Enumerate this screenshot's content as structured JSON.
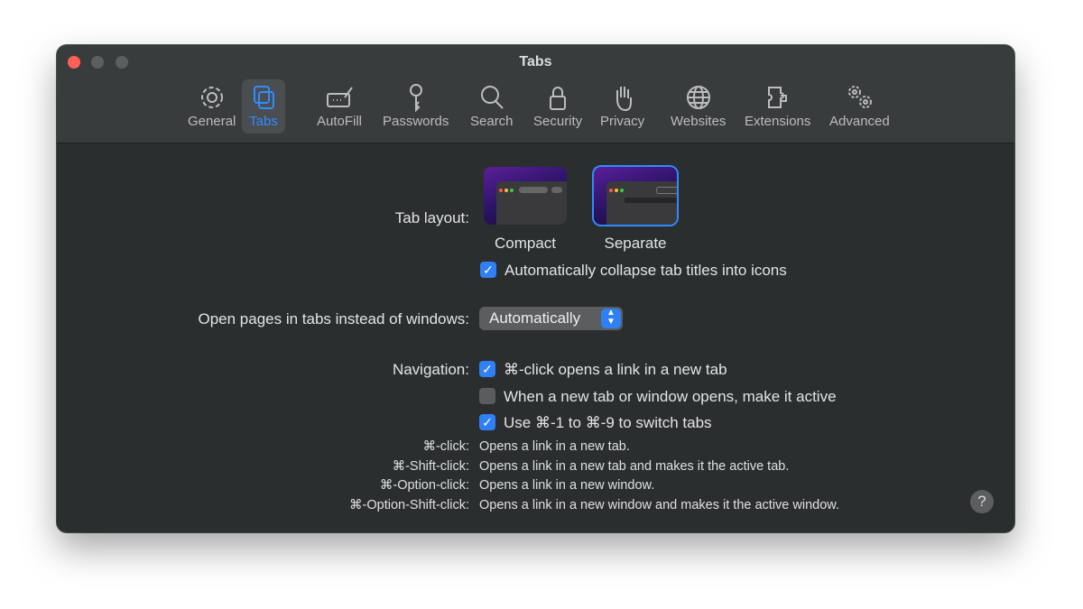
{
  "window": {
    "title": "Tabs"
  },
  "toolbar": [
    {
      "label": "General",
      "icon": "gear-icon"
    },
    {
      "label": "Tabs",
      "icon": "tabs-icon",
      "active": true
    },
    {
      "label": "AutoFill",
      "icon": "autofill-icon"
    },
    {
      "label": "Passwords",
      "icon": "key-icon"
    },
    {
      "label": "Search",
      "icon": "search-icon"
    },
    {
      "label": "Security",
      "icon": "lock-icon"
    },
    {
      "label": "Privacy",
      "icon": "hand-icon"
    },
    {
      "label": "Websites",
      "icon": "globe-icon"
    },
    {
      "label": "Extensions",
      "icon": "puzzle-icon"
    },
    {
      "label": "Advanced",
      "icon": "gears-icon"
    }
  ],
  "tab_layout": {
    "label": "Tab layout:",
    "options": [
      "Compact",
      "Separate"
    ],
    "selected": "Separate"
  },
  "collapse": {
    "label": "Automatically collapse tab titles into icons",
    "checked": true
  },
  "open_pages": {
    "label": "Open pages in tabs instead of windows:",
    "value": "Automatically"
  },
  "navigation": {
    "label": "Navigation:",
    "items": [
      {
        "label": "⌘-click opens a link in a new tab",
        "checked": true
      },
      {
        "label": "When a new tab or window opens, make it active",
        "checked": false
      },
      {
        "label": "Use ⌘-1 to ⌘-9 to switch tabs",
        "checked": true
      }
    ]
  },
  "shortcuts": [
    {
      "key": "⌘-click:",
      "desc": "Opens a link in a new tab."
    },
    {
      "key": "⌘-Shift-click:",
      "desc": "Opens a link in a new tab and makes it the active tab."
    },
    {
      "key": "⌘-Option-click:",
      "desc": "Opens a link in a new window."
    },
    {
      "key": "⌘-Option-Shift-click:",
      "desc": "Opens a link in a new window and makes it the active window."
    }
  ],
  "help": "?",
  "colors": {
    "accent": "#2f7ff6"
  }
}
